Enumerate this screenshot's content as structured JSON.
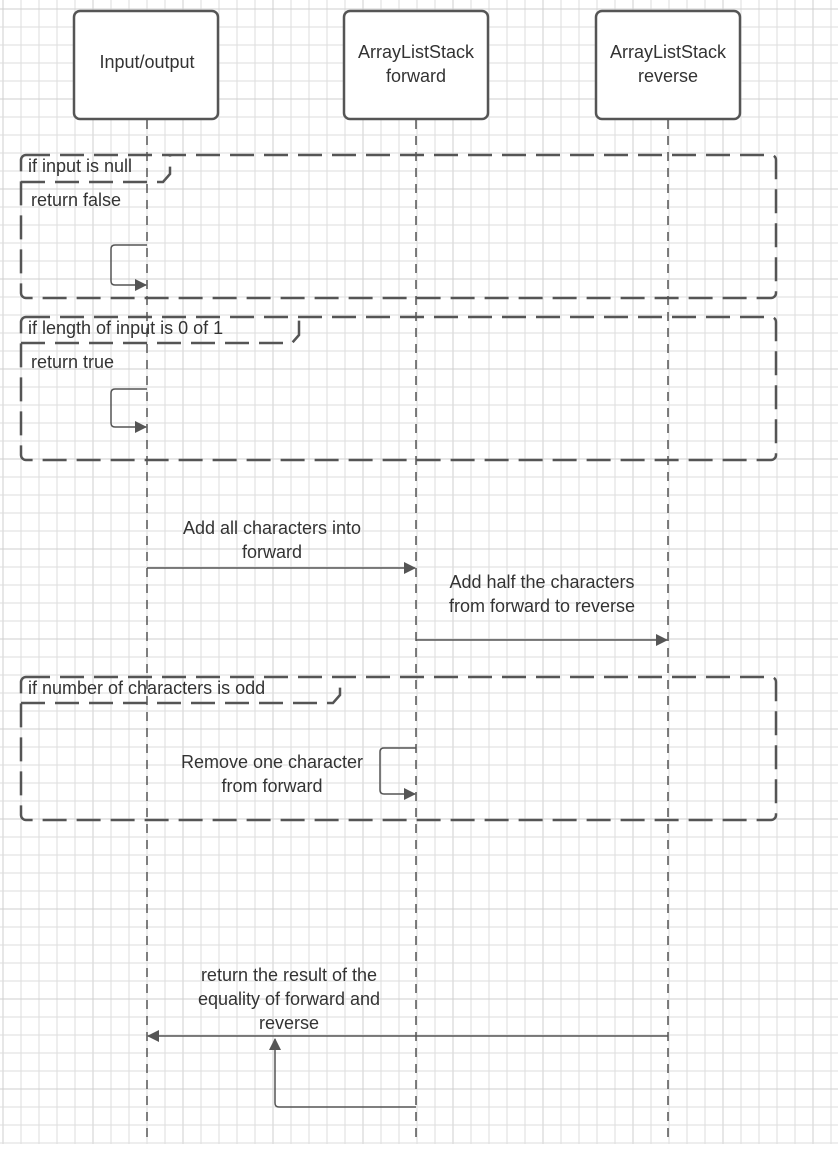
{
  "colors": {
    "background": "#ffffff",
    "grid_minor": "#dedede",
    "grid_major": "#cfcfcf",
    "line": "#555555",
    "text": "#333333"
  },
  "participants": [
    {
      "id": "io",
      "label": [
        "Input/output"
      ]
    },
    {
      "id": "forward",
      "label": [
        "ArrayListStack",
        "forward"
      ]
    },
    {
      "id": "reverse",
      "label": [
        "ArrayListStack",
        "reverse"
      ]
    }
  ],
  "frames": [
    {
      "id": "null-check",
      "condition": "if input is null",
      "inner_text": "return false"
    },
    {
      "id": "length-check",
      "condition": "if length of input is 0 of 1",
      "inner_text": "return true"
    },
    {
      "id": "odd-check",
      "condition": "if number of characters is odd",
      "inner_text": ""
    }
  ],
  "messages": [
    {
      "id": "add-all",
      "label": [
        "Add all characters into",
        "forward"
      ]
    },
    {
      "id": "add-half",
      "label": [
        "Add half the characters",
        "from forward to reverse"
      ]
    },
    {
      "id": "remove-one",
      "label": [
        "Remove one character",
        "from forward"
      ]
    },
    {
      "id": "return-result",
      "label": [
        "return the result of the",
        "equality of forward and",
        "reverse"
      ]
    }
  ]
}
